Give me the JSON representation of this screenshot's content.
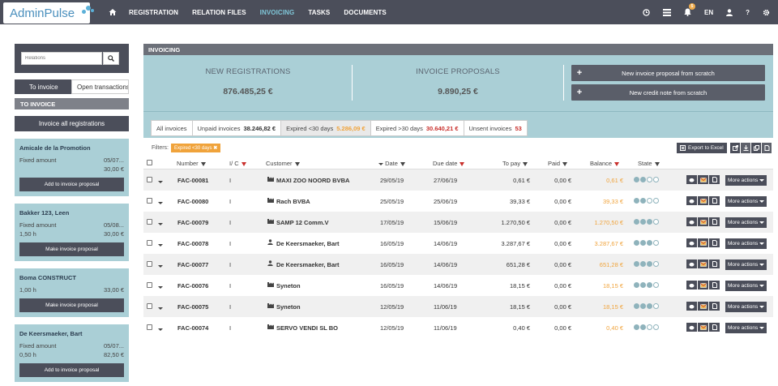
{
  "brand": {
    "name": "AdminPulse"
  },
  "nav": {
    "items": [
      {
        "label": "REGISTRATION",
        "active": false
      },
      {
        "label": "RELATION FILES",
        "active": false
      },
      {
        "label": "INVOICING",
        "active": true
      },
      {
        "label": "TASKS",
        "active": false
      },
      {
        "label": "DOCUMENTS",
        "active": false
      }
    ],
    "right": {
      "notif_count": "5",
      "lang": "EN",
      "help": "?"
    }
  },
  "sidebar": {
    "search_placeholder": "Relations",
    "toggle": {
      "left": "To invoice",
      "right": "Open transactions"
    },
    "section": "TO INVOICE",
    "invoice_all": "Invoice all registrations",
    "cards": [
      {
        "title": "Amicale de la Promotion",
        "lines": [
          [
            "Fixed amount",
            "05/07..."
          ],
          [
            "",
            "30,00 €"
          ]
        ],
        "button": "Add to invoice proposal"
      },
      {
        "title": "Bakker 123, Leen",
        "lines": [
          [
            "Fixed amount",
            "05/08..."
          ],
          [
            "1,50 h",
            "30,00 €"
          ]
        ],
        "button": "Make invoice proposal"
      },
      {
        "title": "Boma CONSTRUCT",
        "lines": [
          [
            "1,00 h",
            "33,00 €"
          ]
        ],
        "button": "Make invoice proposal"
      },
      {
        "title": "De Keersmaeker, Bart",
        "lines": [
          [
            "Fixed amount",
            "05/07..."
          ],
          [
            "0,50 h",
            "82,50 €"
          ]
        ],
        "button": "Add to invoice proposal"
      }
    ]
  },
  "panel": {
    "title": "INVOICING",
    "stats": {
      "new_registrations_label": "NEW REGISTRATIONS",
      "new_registrations_value": "876.485,25 €",
      "proposals_label": "INVOICE PROPOSALS",
      "proposals_value": "9.890,25 €"
    },
    "buttons": {
      "new_proposal": "New invoice proposal from scratch",
      "new_credit": "New credit note from scratch"
    },
    "tabs": [
      {
        "label": "All invoices",
        "value": "",
        "color": "",
        "active": false
      },
      {
        "label": "Unpaid invoices",
        "value": "38.246,82 €",
        "color": "ok",
        "active": false
      },
      {
        "label": "Expired <30 days",
        "value": "5.286,09 €",
        "color": "orange",
        "active": true
      },
      {
        "label": "Expired >30 days",
        "value": "30.640,21 €",
        "color": "red",
        "active": false
      },
      {
        "label": "Unsent invoices",
        "value": "53",
        "color": "red",
        "active": false
      }
    ],
    "filters": {
      "label": "Filters:",
      "chip": "Expired <30 days",
      "export": "Export to Excel"
    },
    "columns": {
      "number": "Number",
      "ic": "I/ C",
      "customer": "Customer",
      "date": "Date",
      "due": "Due date",
      "topay": "To pay",
      "paid": "Paid",
      "balance": "Balance",
      "state": "State"
    },
    "more_label": "More actions",
    "rows": [
      {
        "number": "FAC-00081",
        "ic": "I",
        "customer": "MAXI ZOO NOORD BVBA",
        "ctype": "company",
        "date": "29/05/19",
        "due": "27/06/19",
        "topay": "0,61 €",
        "paid": "0,00 €",
        "balance": "0,61 €",
        "state": [
          1,
          1,
          0,
          0
        ]
      },
      {
        "number": "FAC-00080",
        "ic": "I",
        "customer": "Rach BVBA",
        "ctype": "company",
        "date": "25/05/19",
        "due": "25/06/19",
        "topay": "39,33 €",
        "paid": "0,00 €",
        "balance": "39,33 €",
        "state": [
          1,
          1,
          0,
          0
        ]
      },
      {
        "number": "FAC-00079",
        "ic": "I",
        "customer": "SAMP 12 Comm.V",
        "ctype": "company",
        "date": "17/05/19",
        "due": "15/06/19",
        "topay": "1.270,50 €",
        "paid": "0,00 €",
        "balance": "1.270,50 €",
        "state": [
          1,
          1,
          1,
          0
        ]
      },
      {
        "number": "FAC-00078",
        "ic": "I",
        "customer": "De Keersmaeker, Bart",
        "ctype": "person",
        "date": "16/05/19",
        "due": "14/06/19",
        "topay": "3.287,67 €",
        "paid": "0,00 €",
        "balance": "3.287,67 €",
        "state": [
          1,
          1,
          1,
          0
        ]
      },
      {
        "number": "FAC-00077",
        "ic": "I",
        "customer": "De Keersmaeker, Bart",
        "ctype": "person",
        "date": "16/05/19",
        "due": "14/06/19",
        "topay": "651,28 €",
        "paid": "0,00 €",
        "balance": "651,28 €",
        "state": [
          1,
          1,
          1,
          0
        ]
      },
      {
        "number": "FAC-00076",
        "ic": "I",
        "customer": "Syneton",
        "ctype": "company",
        "date": "16/05/19",
        "due": "14/06/19",
        "topay": "18,15 €",
        "paid": "0,00 €",
        "balance": "18,15 €",
        "state": [
          1,
          1,
          1,
          0
        ]
      },
      {
        "number": "FAC-00075",
        "ic": "I",
        "customer": "Syneton",
        "ctype": "company",
        "date": "12/05/19",
        "due": "11/06/19",
        "topay": "18,15 €",
        "paid": "0,00 €",
        "balance": "18,15 €",
        "state": [
          1,
          1,
          1,
          0
        ]
      },
      {
        "number": "FAC-00074",
        "ic": "I",
        "customer": "SERVO VENDI SL BO",
        "ctype": "company",
        "date": "12/05/19",
        "due": "11/06/19",
        "topay": "0,40 €",
        "paid": "0,00 €",
        "balance": "0,40 €",
        "state": [
          1,
          1,
          0,
          0
        ]
      }
    ]
  },
  "colors": {
    "dark": "#4b4e5a",
    "teal": "#aacfd6",
    "orange": "#f0a33b",
    "red": "#c9302c",
    "dotOn": "#8fb3bc",
    "dotOff": "#ffffff"
  }
}
